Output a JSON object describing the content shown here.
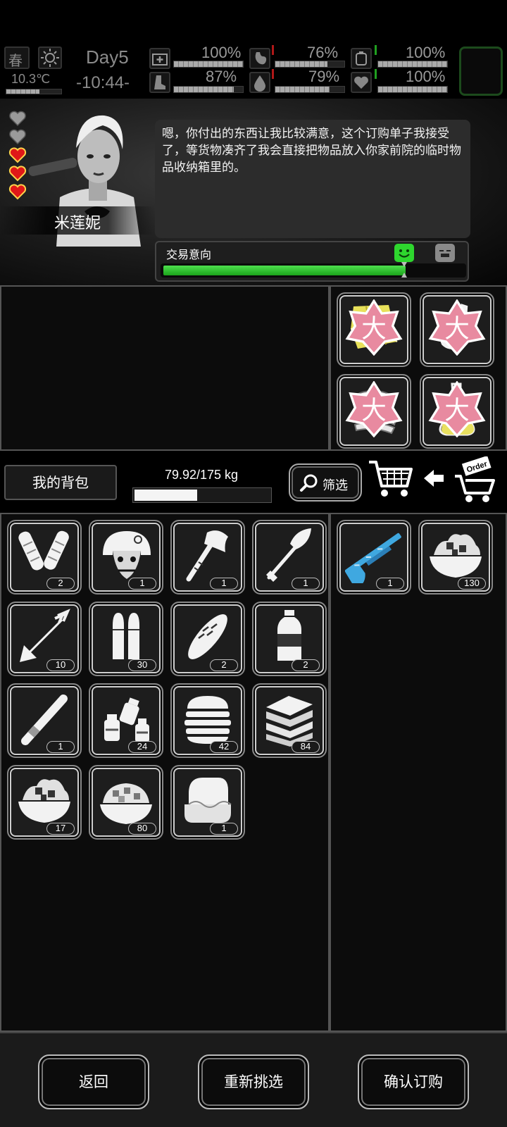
{
  "status": {
    "season": "春",
    "day": "Day5",
    "temperature": "10.3℃",
    "time": "-10:44-",
    "stats": [
      {
        "icon": "medkit-icon",
        "value": "100%",
        "level": 1.0
      },
      {
        "icon": "stomach-icon",
        "value": "76%",
        "level": 0.76
      },
      {
        "icon": "battery-icon",
        "value": "100%",
        "level": 1.0
      },
      {
        "icon": "boot-icon",
        "value": "87%",
        "level": 0.87
      },
      {
        "icon": "water-drop-icon",
        "value": "79%",
        "level": 0.79
      },
      {
        "icon": "heart-icon",
        "value": "100%",
        "level": 1.0
      }
    ]
  },
  "npc": {
    "name": "米莲妮",
    "hearts_filled": 3,
    "hearts_total": 5,
    "dialog": "嗯，你付出的东西让我比较满意，这个订购单子我接受了，等货物凑齐了我会直接把物品放入你家前院的临时物品收纳箱里的。",
    "trade_label": "交易意向",
    "trade_level": 0.8
  },
  "offer_panel": {
    "items": [
      {
        "icon": "cloth-icon",
        "badge": "大"
      },
      {
        "icon": "plastic-bottle-icon",
        "badge": "大"
      },
      {
        "icon": "tape-roll-icon",
        "badge": "大"
      },
      {
        "icon": "chemical-flask-icon",
        "badge": "大"
      }
    ]
  },
  "toolbar": {
    "bag_label": "我的背包",
    "weight_text": "79.92/175 kg",
    "weight_fraction": 0.4567,
    "filter_label": "筛选",
    "order_label": "Order"
  },
  "backpack": {
    "items": [
      {
        "icon": "knee-pads-icon",
        "count": "2"
      },
      {
        "icon": "tactical-helmet-icon",
        "count": "1"
      },
      {
        "icon": "hatchet-icon",
        "count": "1"
      },
      {
        "icon": "shovel-icon",
        "count": "1"
      },
      {
        "icon": "arrow-icon",
        "count": "10"
      },
      {
        "icon": "bullets-icon",
        "count": "30"
      },
      {
        "icon": "bread-icon",
        "count": "2"
      },
      {
        "icon": "water-bottle-icon",
        "count": "2"
      },
      {
        "icon": "cigarette-icon",
        "count": "1"
      },
      {
        "icon": "seasoning-bottles-icon",
        "count": "24"
      },
      {
        "icon": "burger-icon",
        "count": "42"
      },
      {
        "icon": "sandwich-stack-icon",
        "count": "84"
      },
      {
        "icon": "salad-bowl-icon",
        "count": "17"
      },
      {
        "icon": "rice-bowl-icon",
        "count": "80"
      },
      {
        "icon": "folded-cloth-icon",
        "count": "1"
      }
    ]
  },
  "order_panel": {
    "items": [
      {
        "icon": "shotgun-icon",
        "count": "1"
      },
      {
        "icon": "salad-bowl-icon",
        "count": "130"
      }
    ]
  },
  "buttons": {
    "back": "返回",
    "reselect": "重新挑选",
    "confirm": "确认订购"
  }
}
